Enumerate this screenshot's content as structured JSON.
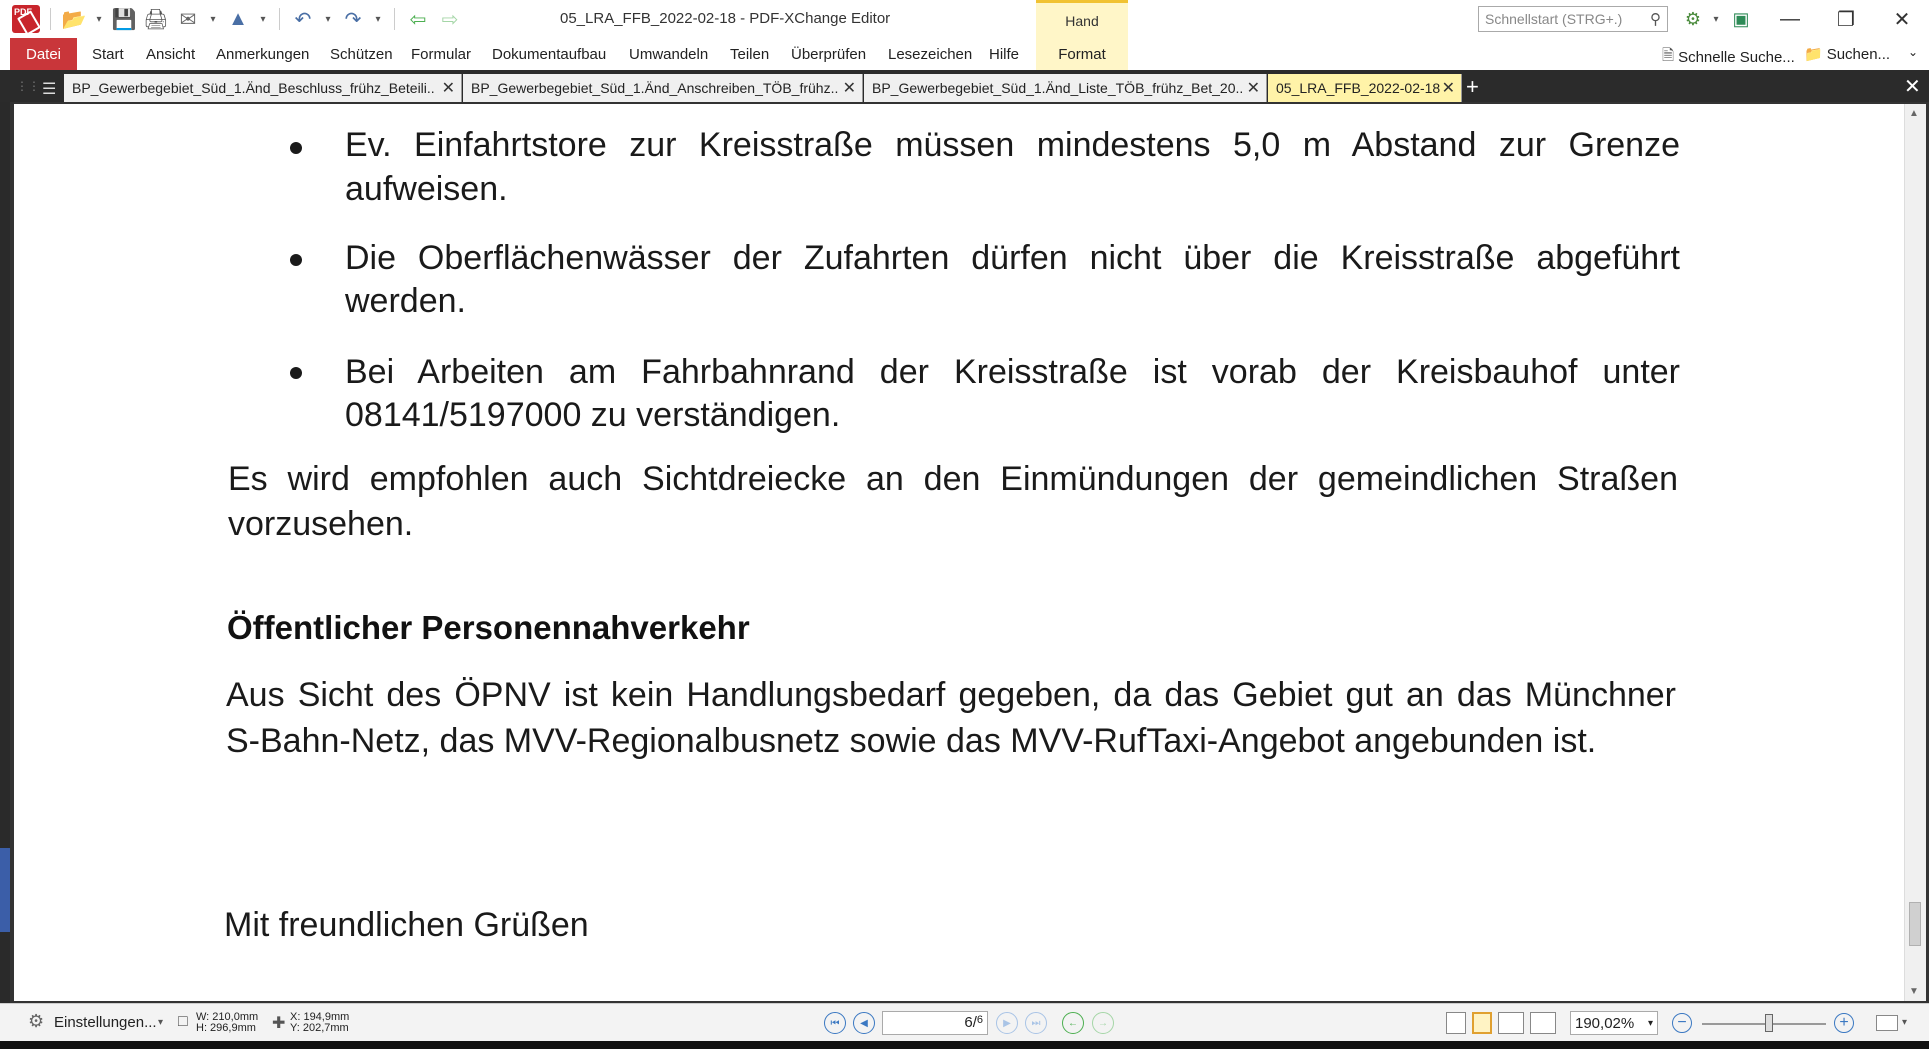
{
  "window": {
    "title": "05_LRA_FFB_2022-02-18 - PDF-XChange Editor",
    "context_tab": "Hand",
    "quick_search_placeholder": "Schnellstart (STRG+.)"
  },
  "menu": {
    "file": "Datei",
    "items": [
      "Start",
      "Ansicht",
      "Anmerkungen",
      "Schützen",
      "Formular",
      "Dokumentaufbau",
      "Umwandeln",
      "Teilen",
      "Überprüfen",
      "Lesezeichen",
      "Hilfe"
    ],
    "format": "Format",
    "quick_find": "Schnelle Suche...",
    "find": "Suchen..."
  },
  "tabs": [
    {
      "label": "BP_Gewerbegebiet_Süd_1.Änd_Beschluss_frühz_Beteili..",
      "active": false
    },
    {
      "label": "BP_Gewerbegebiet_Süd_1.Änd_Anschreiben_TÖB_frühz..",
      "active": false
    },
    {
      "label": "BP_Gewerbegebiet_Süd_1.Änd_Liste_TÖB_frühz_Bet_20..",
      "active": false
    },
    {
      "label": "05_LRA_FFB_2022-02-18",
      "active": true
    }
  ],
  "document": {
    "bullets": [
      {
        "line1": "Ev. Einfahrtstore zur Kreisstraße müssen mindestens 5,0 m Abstand zur Grenze",
        "line2": "aufweisen."
      },
      {
        "line1": "Die Oberflächenwässer der Zufahrten dürfen nicht über die Kreisstraße abgeführt",
        "line2": "werden."
      },
      {
        "line1": "Bei Arbeiten am Fahrbahnrand der Kreisstraße ist vorab der Kreisbauhof unter",
        "line2": "08141/5197000 zu verständigen."
      }
    ],
    "paragraph1": {
      "line1": "Es wird empfohlen auch Sichtdreiecke an den Einmündungen der gemeindlichen Straßen",
      "line2": "vorzusehen."
    },
    "heading": "Öffentlicher Personennahverkehr",
    "paragraph2": {
      "line1": "Aus Sicht des ÖPNV ist kein Handlungsbedarf gegeben, da das Gebiet gut an das Münchner",
      "line2": "S-Bahn-Netz, das MVV-Regionalbusnetz sowie das MVV-RufTaxi-Angebot angebunden ist."
    },
    "closing": "Mit freundlichen Grüßen"
  },
  "status": {
    "settings": "Einstellungen...",
    "width": "W: 210,0mm",
    "height": "H: 296,9mm",
    "x": "X: 194,9mm",
    "y": "Y: 202,7mm",
    "page_current": "6",
    "page_total": "6",
    "zoom": "190,02%"
  },
  "colors": {
    "file_menu": "#c9363a",
    "active_tab": "#fff3a8",
    "context_tab": "#fff6c8",
    "nav_blue": "#3a78c2"
  }
}
